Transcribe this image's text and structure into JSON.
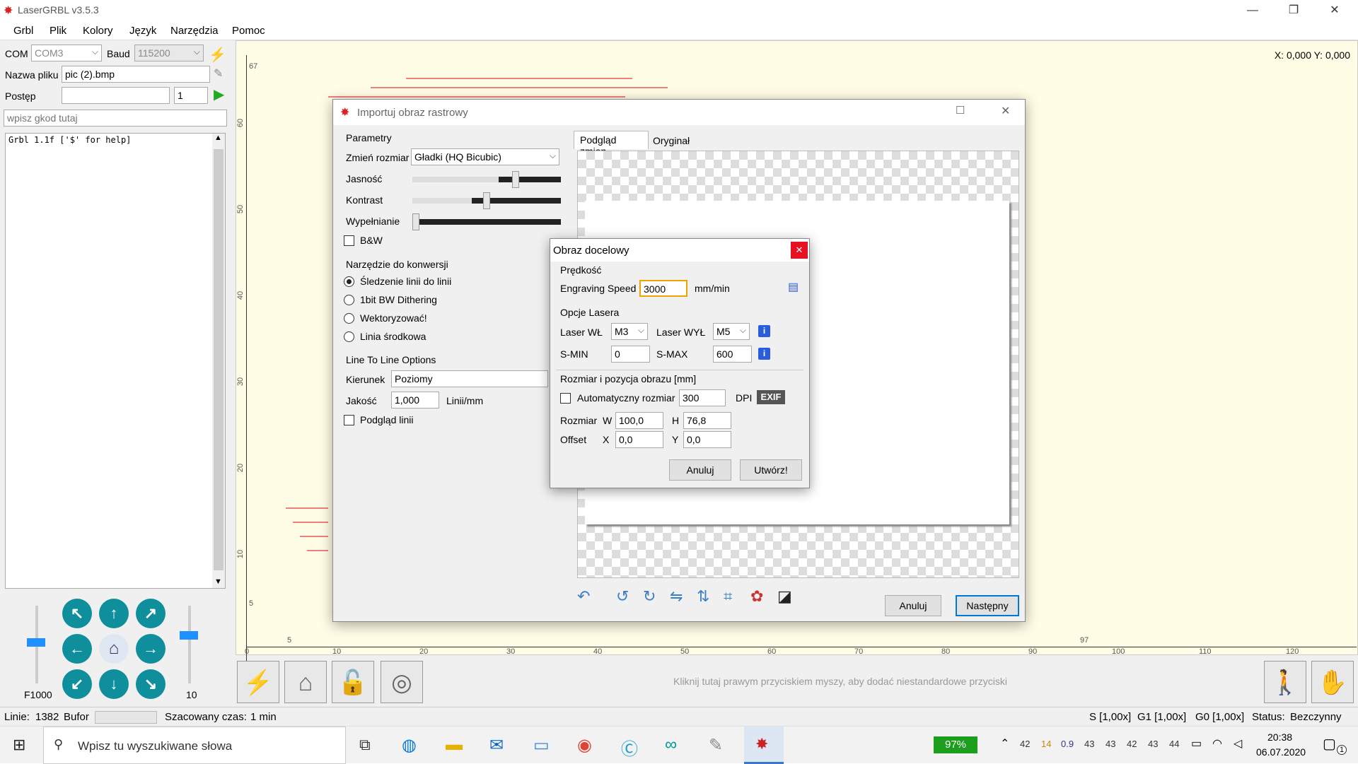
{
  "app": {
    "title": "LaserGRBL v3.5.3"
  },
  "menu": [
    "Grbl",
    "Plik",
    "Kolory",
    "Język",
    "Narzędzia",
    "Pomoc"
  ],
  "connection": {
    "com_label": "COM",
    "com_value": "COM3",
    "baud_label": "Baud",
    "baud_value": "115200"
  },
  "file": {
    "label": "Nazwa pliku",
    "value": "pic (2).bmp"
  },
  "progress": {
    "label": "Postęp",
    "copies": "1"
  },
  "gcode_input": {
    "placeholder": "wpisz gkod tutaj"
  },
  "console": {
    "lines": [
      "Grbl 1.1f ['$' for help]"
    ]
  },
  "jog": {
    "feed_label": "F1000",
    "step_label": "10"
  },
  "canvas": {
    "coords": "X: 0,000 Y: 0,000",
    "hint": "Kliknij tutaj prawym przyciskiem myszy, aby dodać niestandardowe przyciski",
    "y_ticks": [
      "67",
      "60",
      "50",
      "40",
      "30",
      "20",
      "10",
      "5",
      "0"
    ],
    "x_ticks": [
      "0",
      "5",
      "10",
      "20",
      "30",
      "40",
      "50",
      "60",
      "70",
      "80",
      "90",
      "97",
      "100",
      "110",
      "120"
    ]
  },
  "status": {
    "lines_label": "Linie:",
    "lines_value": "1382",
    "buffer_label": "Bufor",
    "time_label": "Szacowany czas:",
    "time_value": "1 min",
    "s_override": "S [1,00x]",
    "g1_override": "G1 [1,00x]",
    "g0_override": "G0 [1,00x]",
    "state_label": "Status:",
    "state_value": "Bezczynny"
  },
  "import_dialog": {
    "title": "Importuj obraz rastrowy",
    "params_title": "Parametry",
    "resize_label": "Zmień rozmiar",
    "resize_value": "Gładki (HQ Bicubic)",
    "brightness_label": "Jasność",
    "contrast_label": "Kontrast",
    "fill_label": "Wypełnianie",
    "bw_label": "B&W",
    "brightness_level": 0.7,
    "contrast_level": 0.5,
    "fill_level": 0.02,
    "tool_title": "Narzędzie do konwersji",
    "tools": [
      "Śledzenie linii do linii",
      "1bit BW Dithering",
      "Wektoryzować!",
      "Linia środkowa"
    ],
    "selected_tool": 0,
    "l2l_title": "Line To Line Options",
    "direction_label": "Kierunek",
    "direction_value": "Poziomy",
    "quality_label": "Jakość",
    "quality_value": "1,000",
    "quality_unit": "Linii/mm",
    "preview_label": "Podgląd linii",
    "tabs": [
      "Podgląd zmian",
      "Oryginał"
    ],
    "cancel": "Anuluj",
    "next": "Następny"
  },
  "target_dialog": {
    "title": "Obraz docelowy",
    "speed_title": "Prędkość",
    "speed_label": "Engraving Speed",
    "speed_value": "3000",
    "speed_unit": "mm/min",
    "laser_title": "Opcje Lasera",
    "laser_on_label": "Laser WŁ",
    "laser_on_value": "M3",
    "laser_off_label": "Laser WYŁ",
    "laser_off_value": "M5",
    "smin_label": "S-MIN",
    "smin_value": "0",
    "smax_label": "S-MAX",
    "smax_value": "600",
    "size_title": "Rozmiar i pozycja obrazu [mm]",
    "auto_label": "Automatyczny rozmiar",
    "dpi_value": "300",
    "dpi_label": "DPI",
    "exif": "EXIF",
    "size_label": "Rozmiar",
    "w_label": "W",
    "w_value": "100,0",
    "h_label": "H",
    "h_value": "76,8",
    "offset_label": "Offset",
    "x_label": "X",
    "x_value": "0,0",
    "y_label": "Y",
    "y_value": "0,0",
    "cancel": "Anuluj",
    "create": "Utwórz!"
  },
  "taskbar": {
    "search_placeholder": "Wpisz tu wyszukiwane słowa",
    "battery": "97%",
    "tray_numbers": [
      "42",
      "14",
      "0.9",
      "43",
      "43",
      "42",
      "43",
      "44"
    ],
    "time": "20:38",
    "date": "06.07.2020",
    "notifications": "1"
  }
}
